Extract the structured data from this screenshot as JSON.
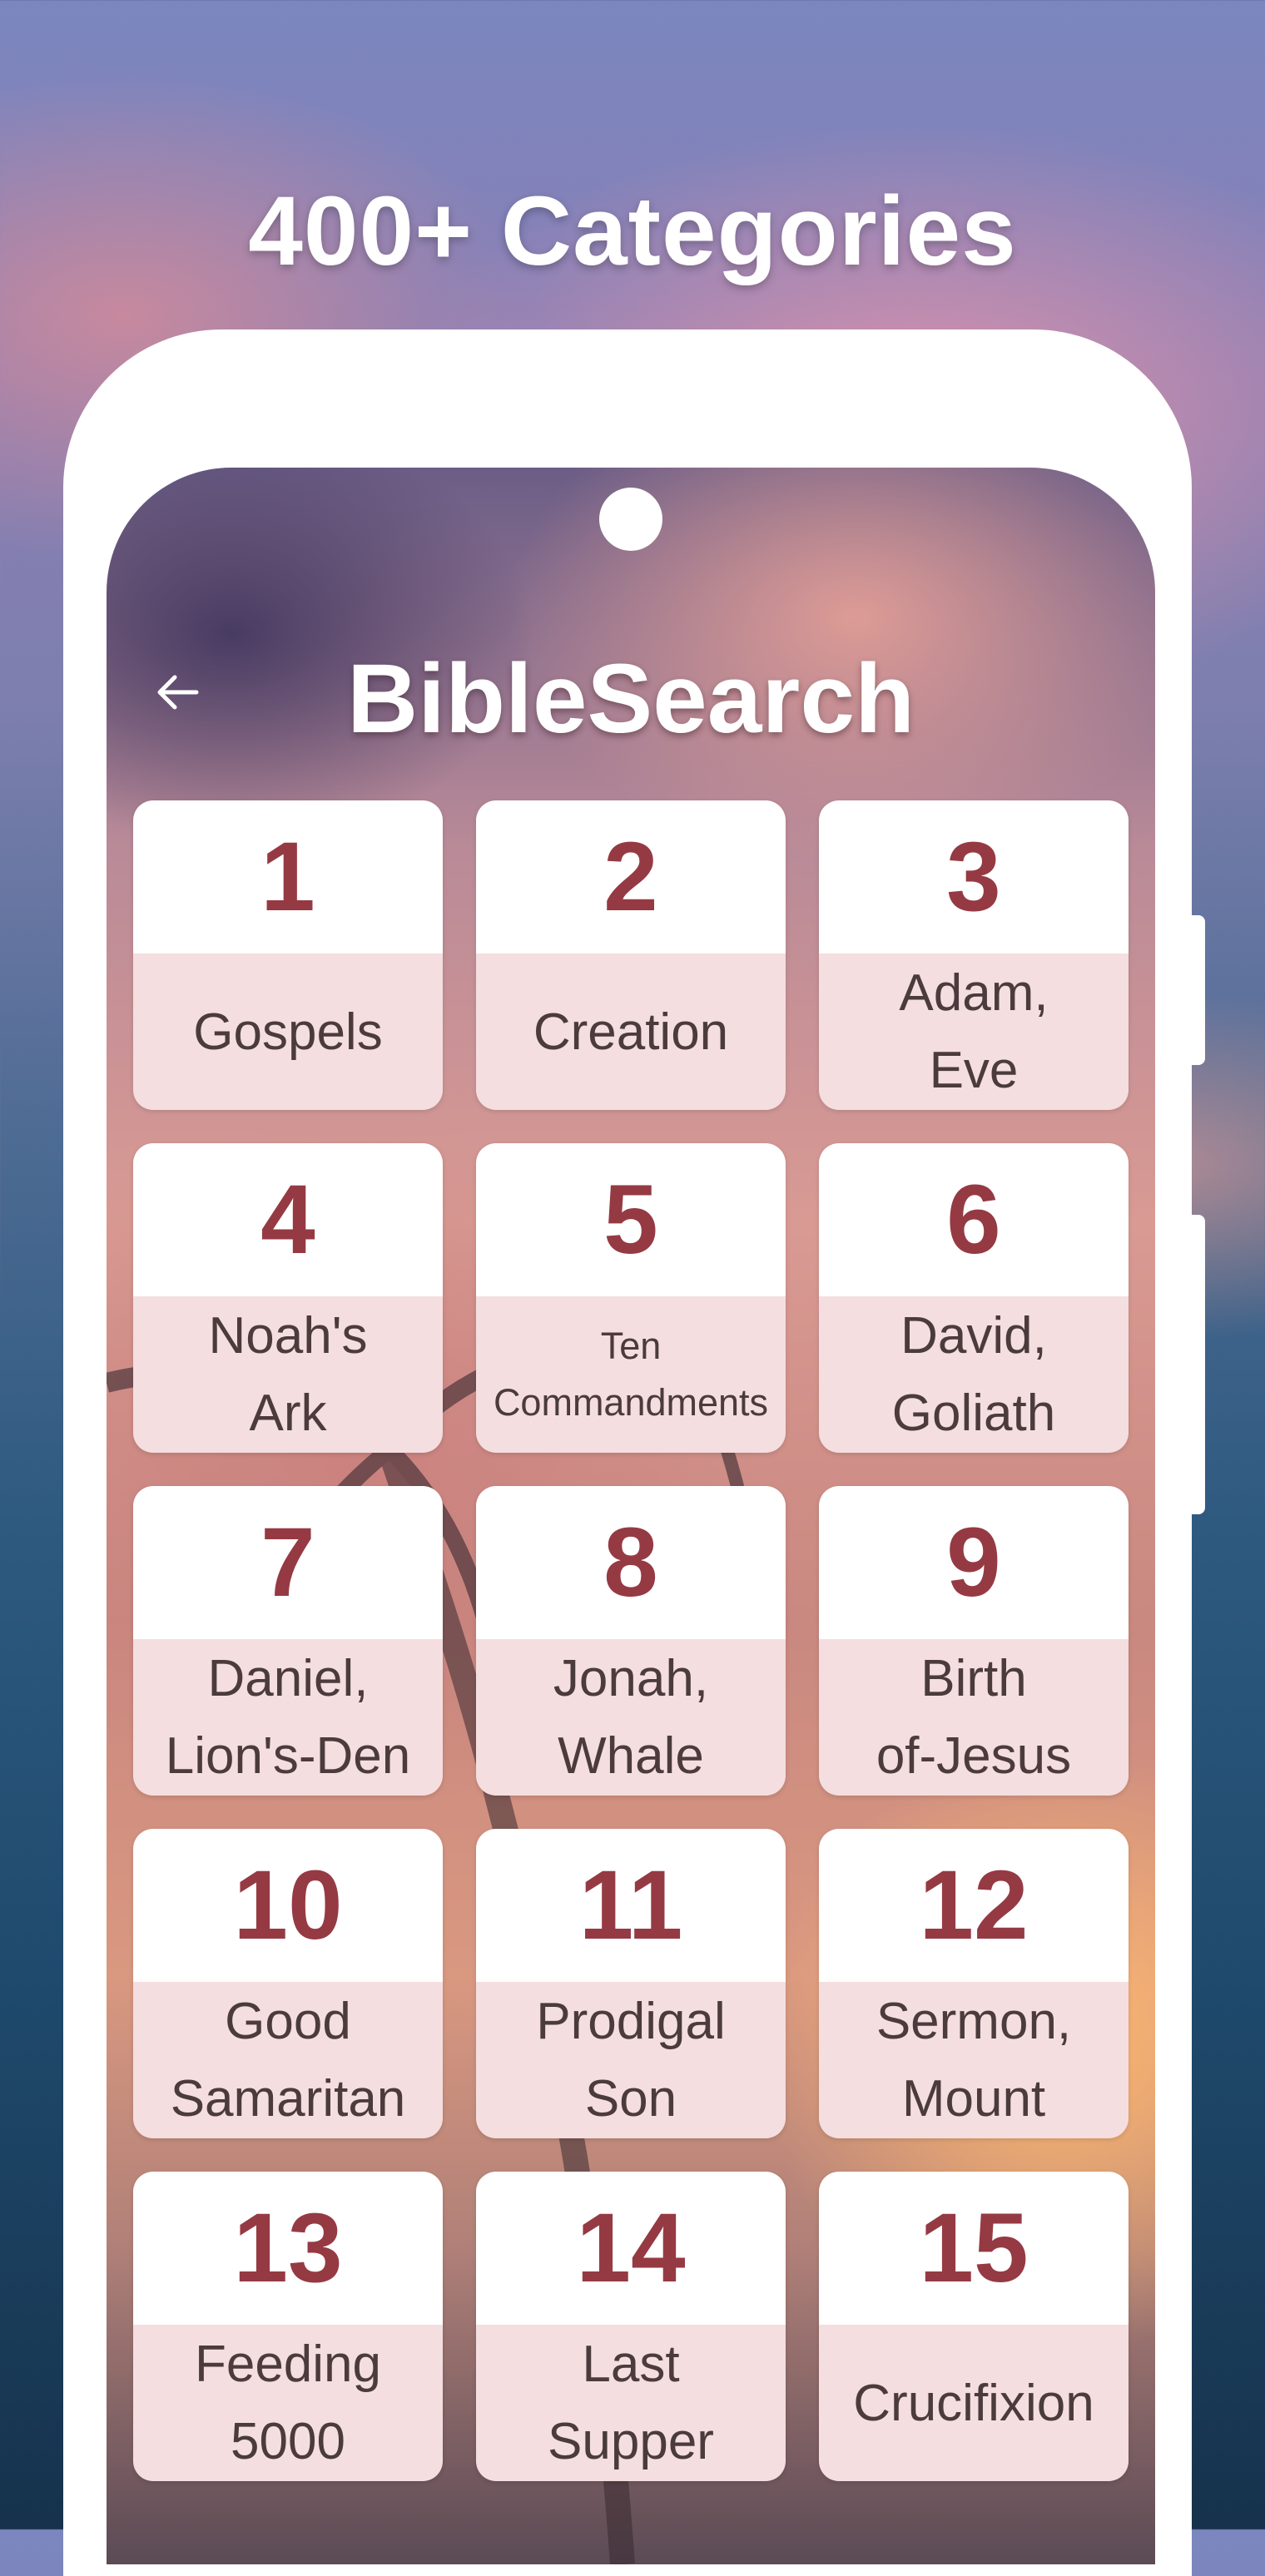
{
  "store_headline": "400+ Categories",
  "app": {
    "title": "BibleSearch",
    "back_icon": "arrow-left-icon"
  },
  "colors": {
    "number_text": "#953a43",
    "label_bg": "#f4dedf",
    "label_text": "#4b3b3d"
  },
  "categories": [
    {
      "number": "1",
      "label": "Gospels"
    },
    {
      "number": "2",
      "label": "Creation"
    },
    {
      "number": "3",
      "label": "Adam,\nEve"
    },
    {
      "number": "4",
      "label": "Noah's\nArk"
    },
    {
      "number": "5",
      "label": "Ten\nCommandments"
    },
    {
      "number": "6",
      "label": "David,\nGoliath"
    },
    {
      "number": "7",
      "label": "Daniel,\nLion's-Den"
    },
    {
      "number": "8",
      "label": "Jonah,\nWhale"
    },
    {
      "number": "9",
      "label": "Birth\nof-Jesus"
    },
    {
      "number": "10",
      "label": "Good\nSamaritan"
    },
    {
      "number": "11",
      "label": "Prodigal\nSon"
    },
    {
      "number": "12",
      "label": "Sermon,\nMount"
    },
    {
      "number": "13",
      "label": "Feeding\n5000"
    },
    {
      "number": "14",
      "label": "Last\nSupper"
    },
    {
      "number": "15",
      "label": "Crucifixion"
    }
  ]
}
